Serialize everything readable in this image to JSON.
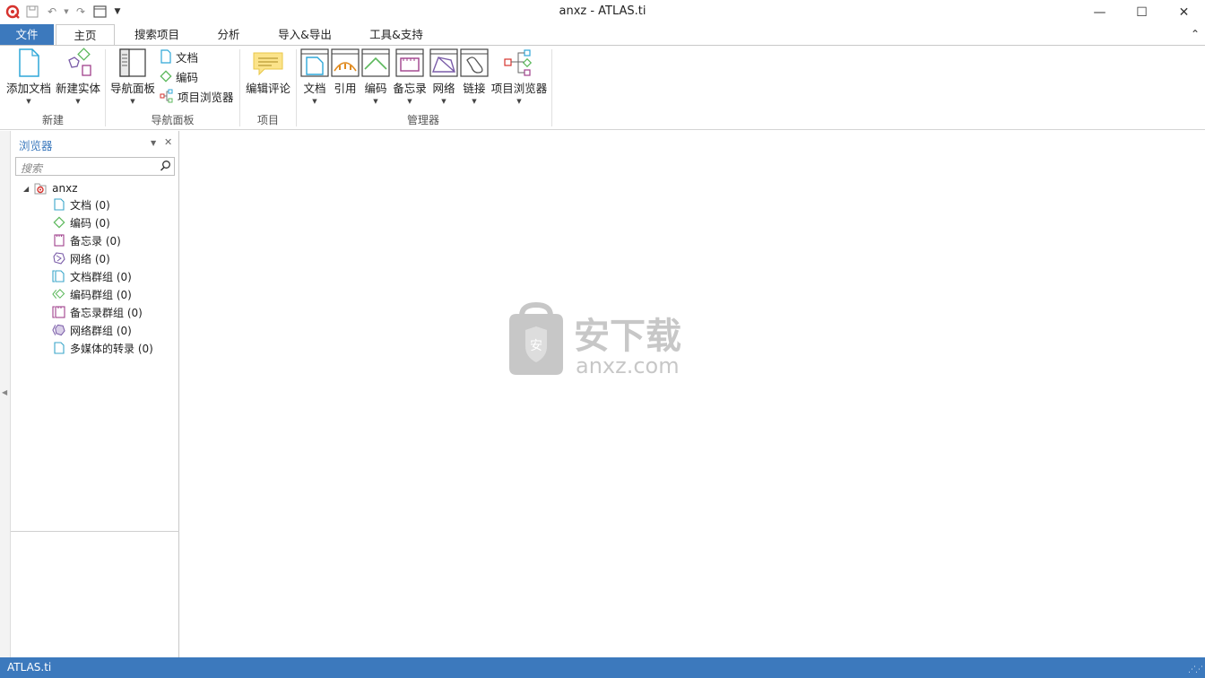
{
  "window": {
    "title": "anxz - ATLAS.ti"
  },
  "tabs": [
    {
      "label": "文件"
    },
    {
      "label": "主页"
    },
    {
      "label": "搜索项目"
    },
    {
      "label": "分析"
    },
    {
      "label": "导入&导出"
    },
    {
      "label": "工具&支持"
    }
  ],
  "ribbon": {
    "groups": {
      "new": "新建",
      "nav": "导航面板",
      "project": "项目",
      "manager": "管理器"
    },
    "buttons": {
      "add_doc": "添加文档",
      "new_entity": "新建实体",
      "nav_panel": "导航面板",
      "doc_small": "文档",
      "code_small": "编码",
      "proj_browser_small": "项目浏览器",
      "edit_comment": "编辑评论",
      "mgr_doc": "文档",
      "mgr_quote": "引用",
      "mgr_code": "编码",
      "mgr_memo": "备忘录",
      "mgr_network": "网络",
      "mgr_link": "链接",
      "mgr_proj_browser": "项目浏览器"
    }
  },
  "browser": {
    "title": "浏览器",
    "search_placeholder": "搜索",
    "root": "anxz",
    "items": [
      {
        "label": "文档 (0)",
        "icon": "document-icon",
        "color": "#3aa6c9"
      },
      {
        "label": "编码 (0)",
        "icon": "code-icon",
        "color": "#5cb85c"
      },
      {
        "label": "备忘录 (0)",
        "icon": "memo-icon",
        "color": "#a0408c"
      },
      {
        "label": "网络 (0)",
        "icon": "network-icon",
        "color": "#7a5ca8"
      },
      {
        "label": "文档群组 (0)",
        "icon": "document-group-icon",
        "color": "#3aa6c9"
      },
      {
        "label": "编码群组 (0)",
        "icon": "code-group-icon",
        "color": "#5cb85c"
      },
      {
        "label": "备忘录群组 (0)",
        "icon": "memo-group-icon",
        "color": "#a0408c"
      },
      {
        "label": "网络群组 (0)",
        "icon": "network-group-icon",
        "color": "#7a5ca8"
      },
      {
        "label": "多媒体的转录 (0)",
        "icon": "transcript-icon",
        "color": "#3aa6c9"
      }
    ]
  },
  "watermark": {
    "text_cn": "安下载",
    "text_en": "anxz.com",
    "badge": "安"
  },
  "status": {
    "text": "ATLAS.ti"
  },
  "colors": {
    "accent": "#3c79bd"
  }
}
